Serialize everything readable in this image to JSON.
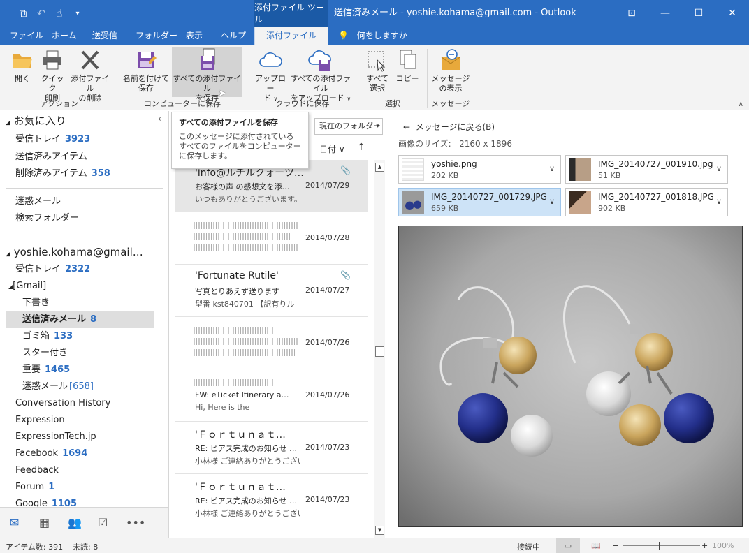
{
  "titlebar": {
    "context_tool": "添付ファイル ツール",
    "title": "送信済みメール - yoshie.kohama@gmail.com - Outlook"
  },
  "tabs": [
    "ファイル",
    "ホーム",
    "送受信",
    "フォルダー",
    "表示",
    "ヘルプ",
    "添付ファイル"
  ],
  "tell_me": "何をしますか",
  "ribbon": {
    "open": "開く",
    "quick_print_1": "クイック",
    "quick_print_2": "印刷",
    "remove_1": "添付ファイル",
    "remove_2": "の削除",
    "group_actions": "アクション",
    "save_as_1": "名前を付けて",
    "save_as_2": "保存",
    "save_all_1": "すべての添付ファイル",
    "save_all_2": "を保存",
    "group_save": "コンピューターに保存",
    "upload_1": "アップロー",
    "upload_2": "ド",
    "upload_all_1": "すべての添付ファイル",
    "upload_all_2": "をアップロード",
    "group_cloud": "クラウドに保存",
    "select_all_1": "すべて",
    "select_all_2": "選択",
    "copy": "コピー",
    "group_select": "選択",
    "show_msg_1": "メッセージ",
    "show_msg_2": "の表示",
    "group_message": "メッセージ"
  },
  "tooltip": {
    "title": "すべての添付ファイルを保存",
    "body": "このメッセージに添付されているすべてのファイルをコンピューターに保存します。"
  },
  "folders": {
    "favorites": "お気に入り",
    "fav_inbox": "受信トレイ",
    "fav_inbox_count": "3923",
    "fav_sent": "送信済みアイテム",
    "fav_deleted": "削除済みアイテム",
    "fav_deleted_count": "358",
    "junk": "迷惑メール",
    "search": "検索フォルダー",
    "account": "yoshie.kohama@gmail…",
    "inbox": "受信トレイ",
    "inbox_count": "2322",
    "gmail": "[Gmail]",
    "drafts": "下書き",
    "sent": "送信済みメール",
    "sent_count": "8",
    "trash": "ゴミ箱",
    "trash_count": "133",
    "starred": "スター付き",
    "important": "重要",
    "important_count": "1465",
    "spam": "迷惑メール",
    "spam_count": "[658]",
    "conv_history": "Conversation History",
    "expression": "Expression",
    "expressiontech": "ExpressionTech.jp",
    "facebook": "Facebook",
    "facebook_count": "1694",
    "feedback": "Feedback",
    "forum": "Forum",
    "forum_count": "1",
    "google": "Google",
    "google_count": "1105"
  },
  "msglist": {
    "scope": "現在のフォルダー",
    "sort": "日付 ∨",
    "messages": [
      {
        "from": "'info@ルチルクォーツ…",
        "subject": "お客様の声 の感想文を添…",
        "preview": "いつもありがとうございます。 今",
        "date": "2014/07/29"
      },
      {
        "from": "",
        "subject": "",
        "preview": "",
        "date": "2014/07/28"
      },
      {
        "from": "'Fortunate Rutile'",
        "subject": "写真とりあえず送ります",
        "preview": "型番 kst840701 【訳有りル",
        "date": "2014/07/27"
      },
      {
        "from": "",
        "subject": "",
        "preview": "",
        "date": "2014/07/26"
      },
      {
        "from": "",
        "subject": "FW: eTicket Itinerary a…",
        "preview": "Hi,          Here is the",
        "date": "2014/07/26"
      },
      {
        "from": "'Ｆｏｒｔｕｎａｔ…",
        "subject": "RE: ピアス完成のお知らせ …",
        "preview": "小林様 ご連絡ありがとうござい",
        "date": "2014/07/23"
      },
      {
        "from": "'Ｆｏｒｔｕｎａｔ…",
        "subject": "RE: ピアス完成のお知らせ …",
        "preview": "小林様 ご連絡ありがとうござい",
        "date": "2014/07/23"
      }
    ]
  },
  "reading": {
    "back": "メッセージに戻る(B)",
    "image_size_label": "画像のサイズ:",
    "image_size": "2160 x 1896",
    "attachments": [
      {
        "name": "yoshie.png",
        "size": "202 KB"
      },
      {
        "name": "IMG_20140727_001910.jpg",
        "size": "51 KB"
      },
      {
        "name": "IMG_20140727_001729.JPG",
        "size": "659 KB"
      },
      {
        "name": "IMG_20140727_001818.JPG",
        "size": "902 KB"
      }
    ]
  },
  "status": {
    "items": "アイテム数: 391",
    "unread": "未読: 8",
    "connected": "接続中",
    "zoom": "100%"
  }
}
